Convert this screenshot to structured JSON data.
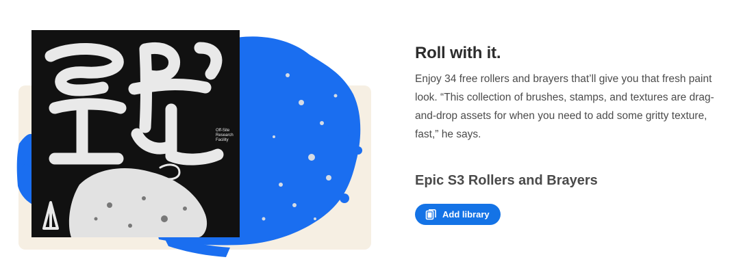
{
  "feature": {
    "heading": "Roll with it.",
    "body": "Enjoy 34 free rollers and brayers that’ll give you that fresh paint look. “This collection of brushes, stamps, and textures are drag-and-drop assets for when you need to add some gritty texture, fast,” he says.",
    "library_title": "Epic S3 Rollers and Brayers",
    "add_button_label": "Add library",
    "add_button_icon": "library-add-icon"
  },
  "poster": {
    "credit_text": "Off-Site Research Facility",
    "colors": {
      "background_card": "#f6efe3",
      "paint_blue": "#1a6ef0",
      "poster_black": "#111111",
      "poster_white": "#e9e9e9"
    }
  },
  "colors": {
    "accent": "#1473e6",
    "heading": "#2c2c2c",
    "body": "#4b4b4b"
  }
}
